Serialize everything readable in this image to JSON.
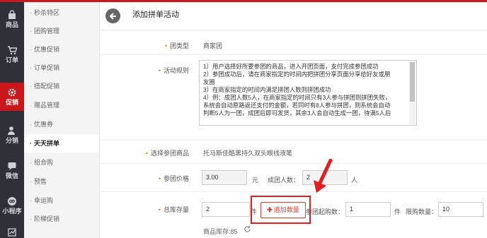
{
  "rail": [
    {
      "label": "商品",
      "icon": "bag-icon",
      "active": false
    },
    {
      "label": "订单",
      "icon": "cart-icon",
      "active": false
    },
    {
      "label": "促销",
      "icon": "gear-icon",
      "active": true
    },
    {
      "label": "分销",
      "icon": "person-icon",
      "active": false
    },
    {
      "label": "微信",
      "icon": "message-icon",
      "active": false
    },
    {
      "label": "小程序",
      "icon": "miniprogram-icon",
      "active": false
    },
    {
      "label": "",
      "icon": "chart-icon",
      "active": false
    }
  ],
  "submenu": [
    "秒杀特区",
    "团购管理",
    "优惠促销",
    "订单促销",
    "搭配促销",
    "赠品管理",
    "优惠券",
    "天天拼单",
    "组合购",
    "预售",
    "幸运购",
    "阶梯促销"
  ],
  "submenu_active": "天天拼单",
  "page": {
    "title": "添加拼单活动"
  },
  "form": {
    "group_type": {
      "label": "团类型",
      "value": "商家团"
    },
    "rules": {
      "label": "活动规则",
      "lines": [
        "1）用户选择好所要参团的商品，进入开团页面，支付完成参团成功",
        "2）参团成功后，请在商家指定的时间内把拼团分享页面分享给好友或朋",
        "友圈",
        "3）在商家指定的时间内满足拼团人数则拼团成功",
        "4）例：成团人数5人，在商家指定的时间只有3人参与拼团则拼团失败，",
        "系统会自动原路返还支付的金额，若同时有8人参与拼团，则系统会自动",
        "判断5人为一团，成团后即可发货，其余3人会自动生成一团，待满5人后"
      ]
    },
    "product": {
      "label": "选择参团商品",
      "value": "托马斯佳酷黑持久双头眼线液笔"
    },
    "price": {
      "label": "参团价格",
      "value": "3.00",
      "unit": "元",
      "group_size_label": "成团人数：",
      "group_size_value": "2",
      "group_size_unit": "人"
    },
    "stock": {
      "label": "总库存量",
      "value": "2",
      "unit": "件",
      "add_button": "追加数量",
      "min_label": "参团起购数：",
      "min_value": "1",
      "min_unit": "件",
      "limit_label": "限购数量：",
      "limit_value": "10",
      "note": "商品库存:85"
    }
  },
  "colors": {
    "accent": "#c9171c",
    "star": "#e08a00",
    "highlight": "#e21e1e"
  }
}
